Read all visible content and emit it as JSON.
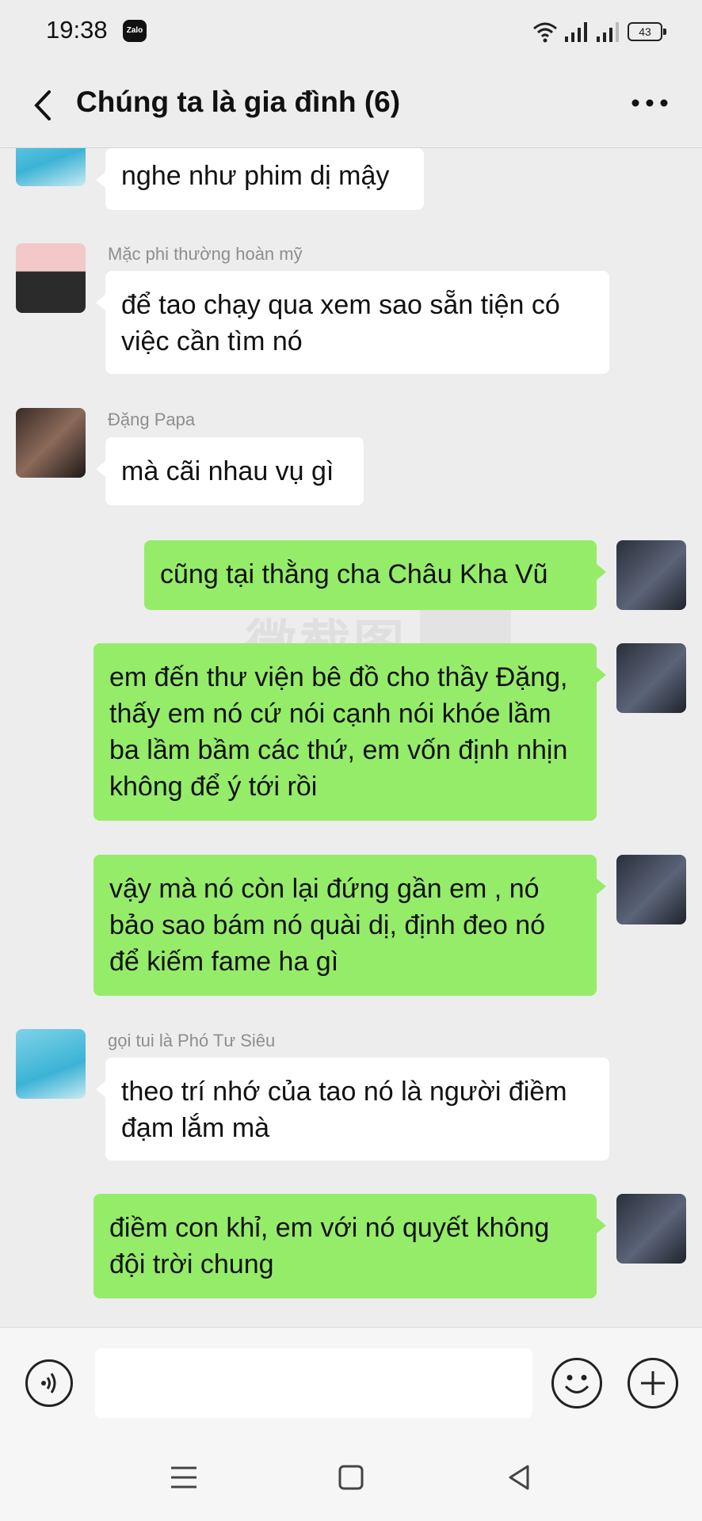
{
  "status_bar": {
    "time": "19:38",
    "app_badge": "Zalo",
    "battery": "43"
  },
  "header": {
    "title": "Chúng ta là gia đình (6)"
  },
  "messages": [
    {
      "side": "in",
      "sender": "",
      "text": "nghe như phim dị mậy"
    },
    {
      "side": "in",
      "sender": "Mặc phi thường hoàn mỹ",
      "text": "để tao chạy qua xem sao sẵn tiện có việc cần tìm nó"
    },
    {
      "side": "in",
      "sender": "Đặng Papa",
      "text": "mà cãi nhau vụ gì"
    },
    {
      "side": "out",
      "sender": "",
      "text": "cũng tại thằng cha Châu Kha Vũ"
    },
    {
      "side": "out",
      "sender": "",
      "text": "em đến thư viện bê đồ cho thầy Đặng, thấy em nó cứ nói cạnh nói khóe lầm ba lầm bầm các thứ, em vốn định nhịn không để ý tới rồi"
    },
    {
      "side": "out",
      "sender": "",
      "text": "vậy mà nó còn lại đứng gần em , nó bảo sao bám nó quài dị, định đeo nó để kiếm fame ha gì"
    },
    {
      "side": "in",
      "sender": "gọi tui là Phó Tư Siêu",
      "text": "theo trí nhớ của tao nó là người điềm đạm lắm mà"
    },
    {
      "side": "out",
      "sender": "",
      "text": "điềm con khỉ, em với nó quyết không đội trời chung"
    }
  ],
  "watermark": "微截图",
  "input": {
    "placeholder": ""
  },
  "colors": {
    "background": "#ededed",
    "outgoing_bubble": "#95ec69",
    "incoming_bubble": "#ffffff"
  }
}
